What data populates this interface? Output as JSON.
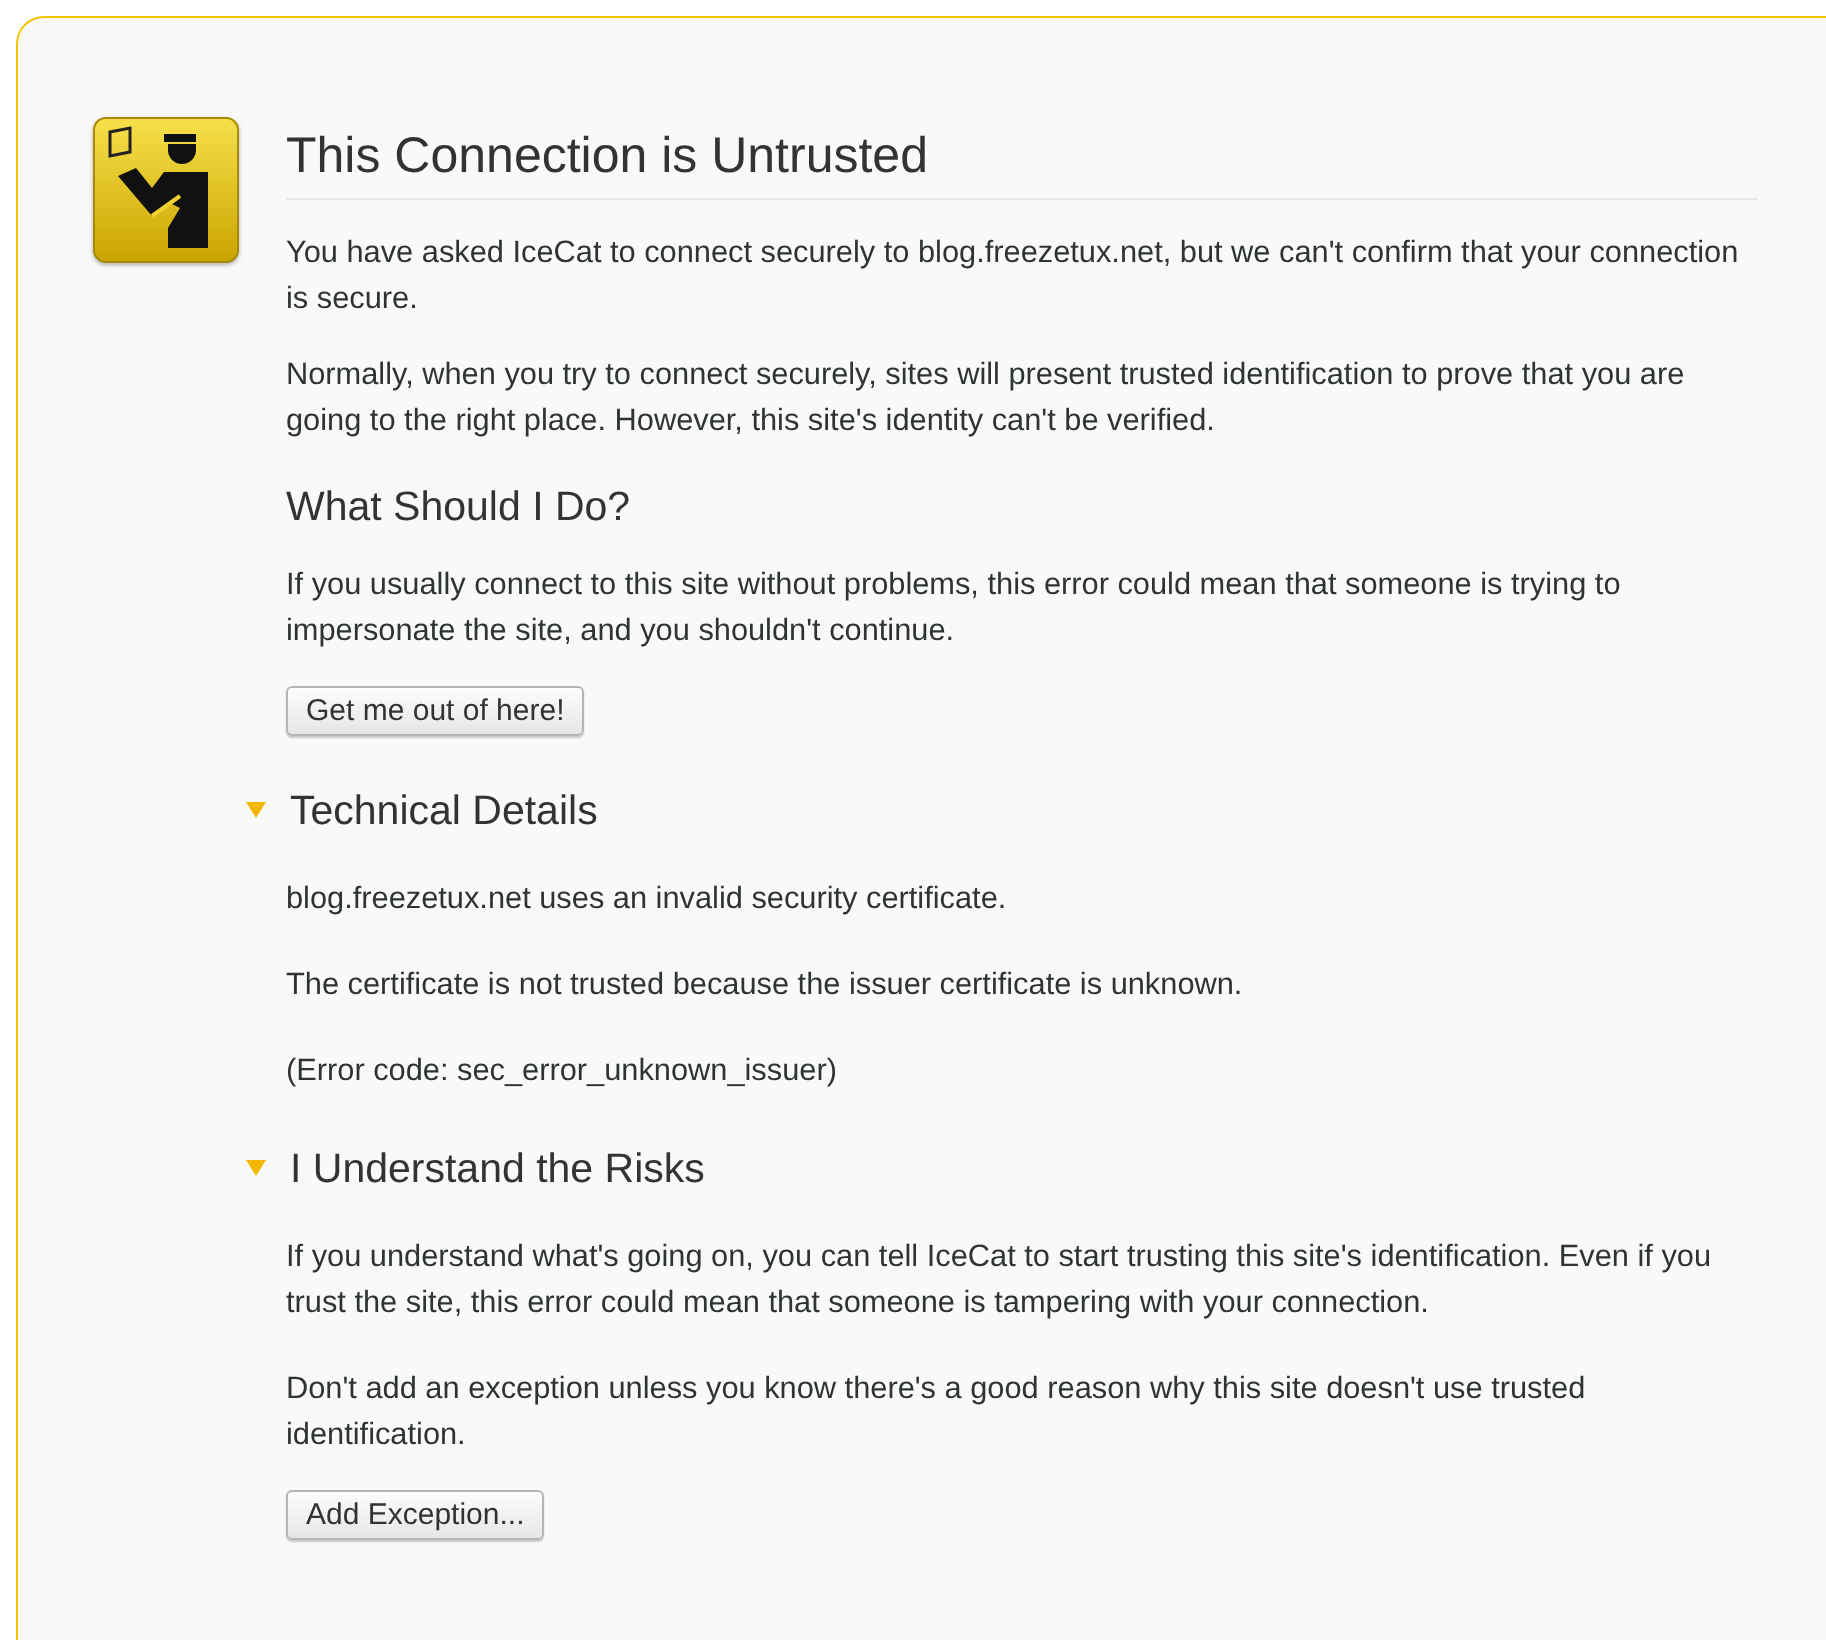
{
  "title": "This Connection is Untrusted",
  "intro": [
    "You have asked IceCat to connect securely to blog.freezetux.net, but we can't confirm that your connection is secure.",
    "Normally, when you try to connect securely, sites will present trusted identification to prove that you are going to the right place. However, this site's identity can't be verified."
  ],
  "what_to_do": {
    "heading": "What Should I Do?",
    "paragraphs": [
      "If you usually connect to this site without problems, this error could mean that someone is trying to impersonate the site, and you shouldn't continue."
    ],
    "button": "Get me out of here!"
  },
  "sections": [
    {
      "heading": "Technical Details",
      "expanded": true,
      "paragraphs": [
        "blog.freezetux.net uses an invalid security certificate.",
        "The certificate is not trusted because the issuer certificate is unknown.",
        "(Error code: sec_error_unknown_issuer)"
      ]
    },
    {
      "heading": "I Understand the Risks",
      "expanded": true,
      "paragraphs": [
        "If you understand what's going on, you can tell IceCat to start trusting this site's identification. Even if you trust the site, this error could mean that someone is tampering with your connection.",
        "Don't add an exception unless you know there's a good reason why this site doesn't use trusted identification."
      ],
      "button": "Add Exception..."
    }
  ]
}
